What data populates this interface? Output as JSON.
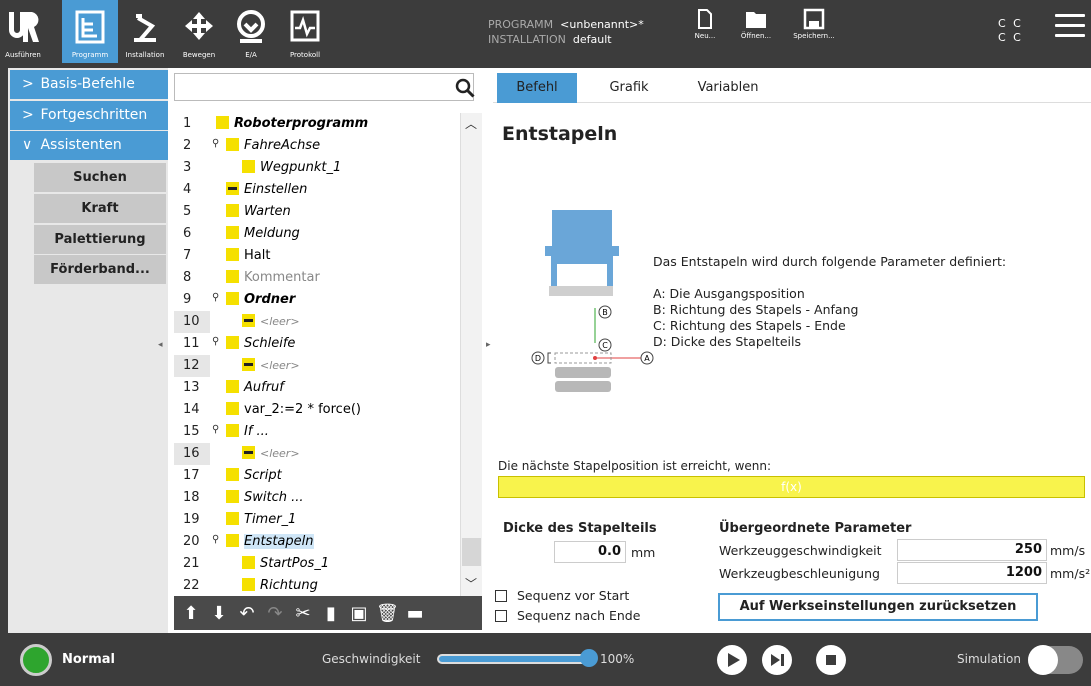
{
  "topbar": {
    "nav": [
      {
        "label": "Ausführen",
        "icon": "ur-logo-icon"
      },
      {
        "label": "Programm",
        "icon": "program-icon"
      },
      {
        "label": "Installation",
        "icon": "robot-arm-icon"
      },
      {
        "label": "Bewegen",
        "icon": "move-cross-icon"
      },
      {
        "label": "E/A",
        "icon": "io-icon"
      },
      {
        "label": "Protokoll",
        "icon": "log-icon"
      }
    ],
    "program_label": "PROGRAMM",
    "program_value": "<unbenannt>*",
    "installation_label": "INSTALLATION",
    "installation_value": "default",
    "file_buttons": [
      {
        "label": "Neu...",
        "icon": "new-file-icon"
      },
      {
        "label": "Öffnen...",
        "icon": "folder-icon"
      },
      {
        "label": "Speichern...",
        "icon": "save-icon"
      }
    ],
    "cc_line1": "C C",
    "cc_line2": "C C"
  },
  "sidebar": {
    "sections": [
      {
        "label": "Basis-Befehle",
        "expanded": false
      },
      {
        "label": "Fortgeschritten",
        "expanded": false
      },
      {
        "label": "Assistenten",
        "expanded": true
      }
    ],
    "items": [
      "Suchen",
      "Kraft",
      "Palettierung",
      "Förderband..."
    ]
  },
  "tree": {
    "search_placeholder": "",
    "rows": [
      {
        "n": "1",
        "text": "Roboterprogramm",
        "style": "bold-italic",
        "icon": "triangle-icon",
        "indent": 0
      },
      {
        "n": "2",
        "text": "FahreAchse",
        "style": "italic",
        "icon": "move-icon",
        "indent": 1,
        "pin": true
      },
      {
        "n": "3",
        "text": "Wegpunkt_1",
        "style": "italic",
        "icon": "waypoint-icon",
        "indent": 2
      },
      {
        "n": "4",
        "text": "Einstellen",
        "style": "italic",
        "icon": "set-icon",
        "indent": 1
      },
      {
        "n": "5",
        "text": "Warten",
        "style": "italic",
        "icon": "hourglass-icon",
        "indent": 1
      },
      {
        "n": "6",
        "text": "Meldung",
        "style": "italic",
        "icon": "message-icon",
        "indent": 1
      },
      {
        "n": "7",
        "text": "Halt",
        "style": "normal",
        "icon": "halt-icon",
        "indent": 1
      },
      {
        "n": "8",
        "text": "Kommentar",
        "style": "grey",
        "icon": "comment-icon",
        "indent": 1
      },
      {
        "n": "9",
        "text": "Ordner",
        "style": "bold-italic",
        "icon": "folder-node-icon",
        "indent": 1,
        "pin": true
      },
      {
        "n": "10",
        "text": "<leer>",
        "style": "empty",
        "icon": "empty-icon",
        "indent": 2,
        "hl": true
      },
      {
        "n": "11",
        "text": "Schleife",
        "style": "italic",
        "icon": "loop-icon",
        "indent": 1,
        "pin": true
      },
      {
        "n": "12",
        "text": "<leer>",
        "style": "empty",
        "icon": "empty-icon",
        "indent": 2,
        "hl": true
      },
      {
        "n": "13",
        "text": "Aufruf",
        "style": "italic",
        "icon": "call-icon",
        "indent": 1
      },
      {
        "n": "14",
        "text": "var_2:=2 * force()",
        "style": "normal",
        "icon": "assign-icon",
        "indent": 1
      },
      {
        "n": "15",
        "text": "If ...",
        "style": "italic",
        "icon": "if-icon",
        "indent": 1,
        "pin": true
      },
      {
        "n": "16",
        "text": "<leer>",
        "style": "empty",
        "icon": "empty-icon",
        "indent": 2,
        "hl": true
      },
      {
        "n": "17",
        "text": "Script",
        "style": "italic",
        "icon": "script-icon",
        "indent": 1
      },
      {
        "n": "18",
        "text": "Switch ...",
        "style": "italic",
        "icon": "switch-icon",
        "indent": 1
      },
      {
        "n": "19",
        "text": "Timer_1",
        "style": "italic",
        "icon": "timer-icon",
        "indent": 1
      },
      {
        "n": "20",
        "text": "Entstapeln",
        "style": "italic",
        "icon": "destack-icon",
        "indent": 1,
        "pin": true,
        "selected": true
      },
      {
        "n": "21",
        "text": "StartPos_1",
        "style": "italic",
        "icon": "waypoint-icon",
        "indent": 2
      },
      {
        "n": "22",
        "text": "Richtung",
        "style": "italic",
        "icon": "direction-icon",
        "indent": 2
      }
    ]
  },
  "tabs": [
    "Befehl",
    "Grafik",
    "Variablen"
  ],
  "panel": {
    "title": "Entstapeln",
    "description": [
      "Das Entstapeln wird durch folgende Parameter definiert:",
      "",
      "A: Die Ausgangsposition",
      "B: Richtung des Stapels - Anfang",
      "C: Richtung des Stapels - Ende",
      "D: Dicke des Stapelteils"
    ],
    "diagram_labels": {
      "a": "A",
      "b": "B",
      "c": "C",
      "d": "D"
    },
    "condition_label": "Die nächste Stapelposition ist erreicht, wenn:",
    "condition_value": "f(x)",
    "thickness_title": "Dicke des Stapelteils",
    "thickness_value": "0.0",
    "thickness_unit": "mm",
    "parent_title": "Übergeordnete Parameter",
    "tool_speed_label": "Werkzeuggeschwindigkeit",
    "tool_speed_value": "250",
    "tool_speed_unit": "mm/s",
    "tool_accel_label": "Werkzeugbeschleunigung",
    "tool_accel_value": "1200",
    "tool_accel_unit": "mm/s²",
    "seq_before": "Sequenz vor Start",
    "seq_after": "Sequenz nach Ende",
    "reset_button": "Auf Werkseinstellungen zurücksetzen"
  },
  "bottombar": {
    "status": "Normal",
    "speed_label": "Geschwindigkeit",
    "speed_value": "100%",
    "speed_fraction": 1.0,
    "simulation_label": "Simulation"
  },
  "colors": {
    "accent": "#4a9bd4",
    "bar": "#3c3c3c",
    "yellow": "#f8f34c",
    "status_green": "#2ea52e"
  }
}
